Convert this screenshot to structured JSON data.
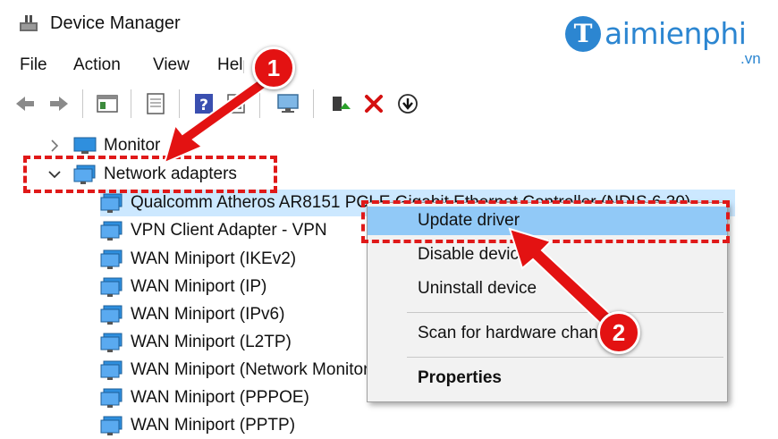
{
  "window": {
    "title": "Device Manager"
  },
  "watermark": {
    "logo_letter": "T",
    "logo_text": "aimienphi",
    "logo_suffix": ".vn"
  },
  "menu": [
    "File",
    "Action",
    "View",
    "Help"
  ],
  "tree": {
    "partial_above": "Monitor",
    "expanded_category": "Network adapters",
    "children": [
      "Qualcomm Atheros AR8151 PCI-E Gigabit Ethernet Controller (NDIS 6.30)",
      "VPN Client Adapter - VPN",
      "WAN Miniport (IKEv2)",
      "WAN Miniport (IP)",
      "WAN Miniport (IPv6)",
      "WAN Miniport (L2TP)",
      "WAN Miniport (Network Monitor)",
      "WAN Miniport (PPPOE)",
      "WAN Miniport (PPTP)"
    ]
  },
  "context_menu": {
    "update": "Update driver",
    "disable": "Disable device",
    "uninstall": "Uninstall device",
    "scan": "Scan for hardware changes",
    "properties": "Properties"
  },
  "annotations": {
    "step1": "1",
    "step2": "2"
  },
  "colors": {
    "highlight_red": "#e01919",
    "selection_blue": "#cce8ff",
    "menu_hover": "#91c9f7",
    "brand_blue": "#2c86d1"
  }
}
